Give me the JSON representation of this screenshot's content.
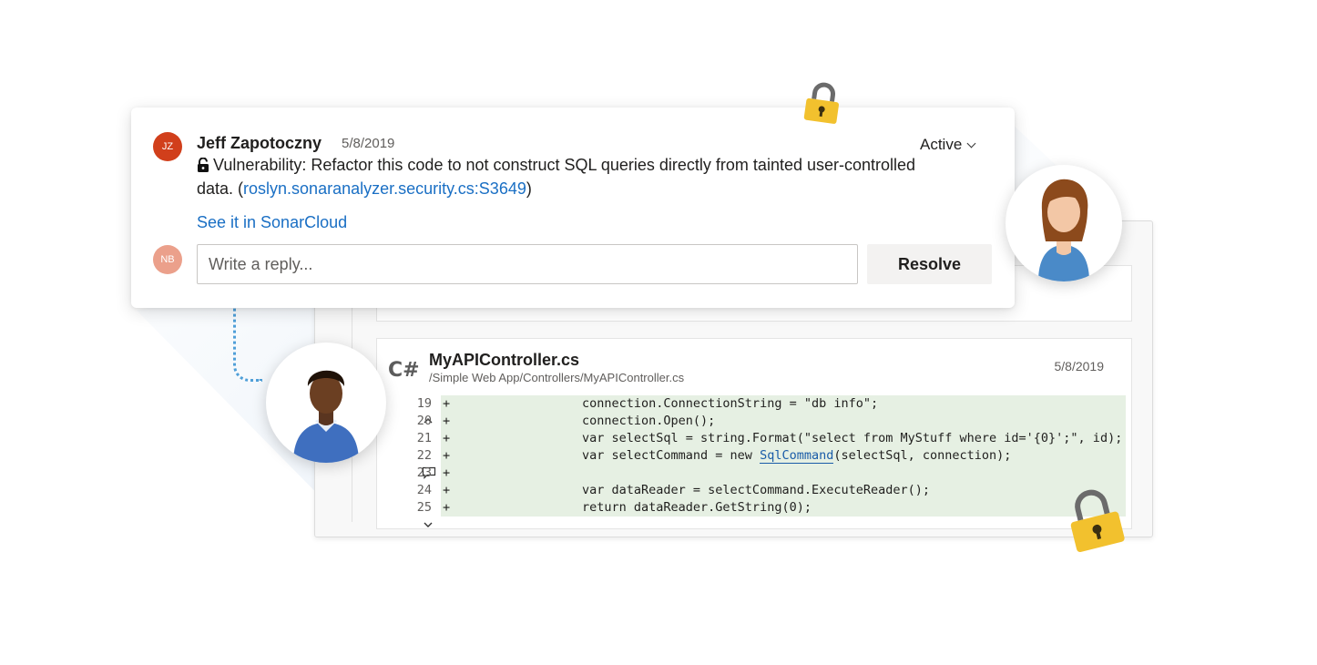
{
  "comment": {
    "author_initials": "JZ",
    "author": "Jeff Zapotoczny",
    "date": "5/8/2019",
    "status": "Active",
    "message_prefix": "Vulnerability: Refactor this code to not construct SQL queries directly from tainted user-controlled data. (",
    "rule_link": "roslyn.sonaranalyzer.security.cs:S3649",
    "message_suffix": ")",
    "see_link": "See it in SonarCloud",
    "reply_initials": "NB",
    "reply_placeholder": "Write a reply...",
    "resolve_label": "Resolve"
  },
  "file": {
    "language_badge": "C#",
    "name": "MyAPIController.cs",
    "path": "/Simple Web App/Controllers/MyAPIController.cs",
    "date": "5/8/2019",
    "lines": [
      {
        "num": "19",
        "sign": "+",
        "marker": "^",
        "code": "connection.ConnectionString = \"db info\";"
      },
      {
        "num": "20",
        "sign": "+",
        "marker": "",
        "code": "connection.Open();"
      },
      {
        "num": "21",
        "sign": "+",
        "marker": "",
        "code": "var selectSql = string.Format(\"select from MyStuff where id='{0}';\", id);"
      },
      {
        "num": "22",
        "sign": "+",
        "marker": "comment",
        "code_before": "var selectCommand = new ",
        "code_link": "SqlCommand",
        "code_after": "(selectSql, connection);"
      },
      {
        "num": "23",
        "sign": "+",
        "marker": "",
        "code": ""
      },
      {
        "num": "24",
        "sign": "+",
        "marker": "",
        "code": "var dataReader = selectCommand.ExecuteReader();"
      },
      {
        "num": "25",
        "sign": "+",
        "marker": "v",
        "code": "return dataReader.GetString(0);"
      }
    ]
  },
  "colors": {
    "accent_link": "#1a6fc4",
    "avatar_jz": "#d13f1b",
    "avatar_nb": "#eba08b",
    "added_line_bg": "#e6f0e3",
    "lock_gold": "#f2c12e"
  },
  "icons": [
    "lock-open-icon",
    "chevron-down-icon",
    "chevron-up-icon",
    "comment-icon",
    "padlock-icon"
  ]
}
